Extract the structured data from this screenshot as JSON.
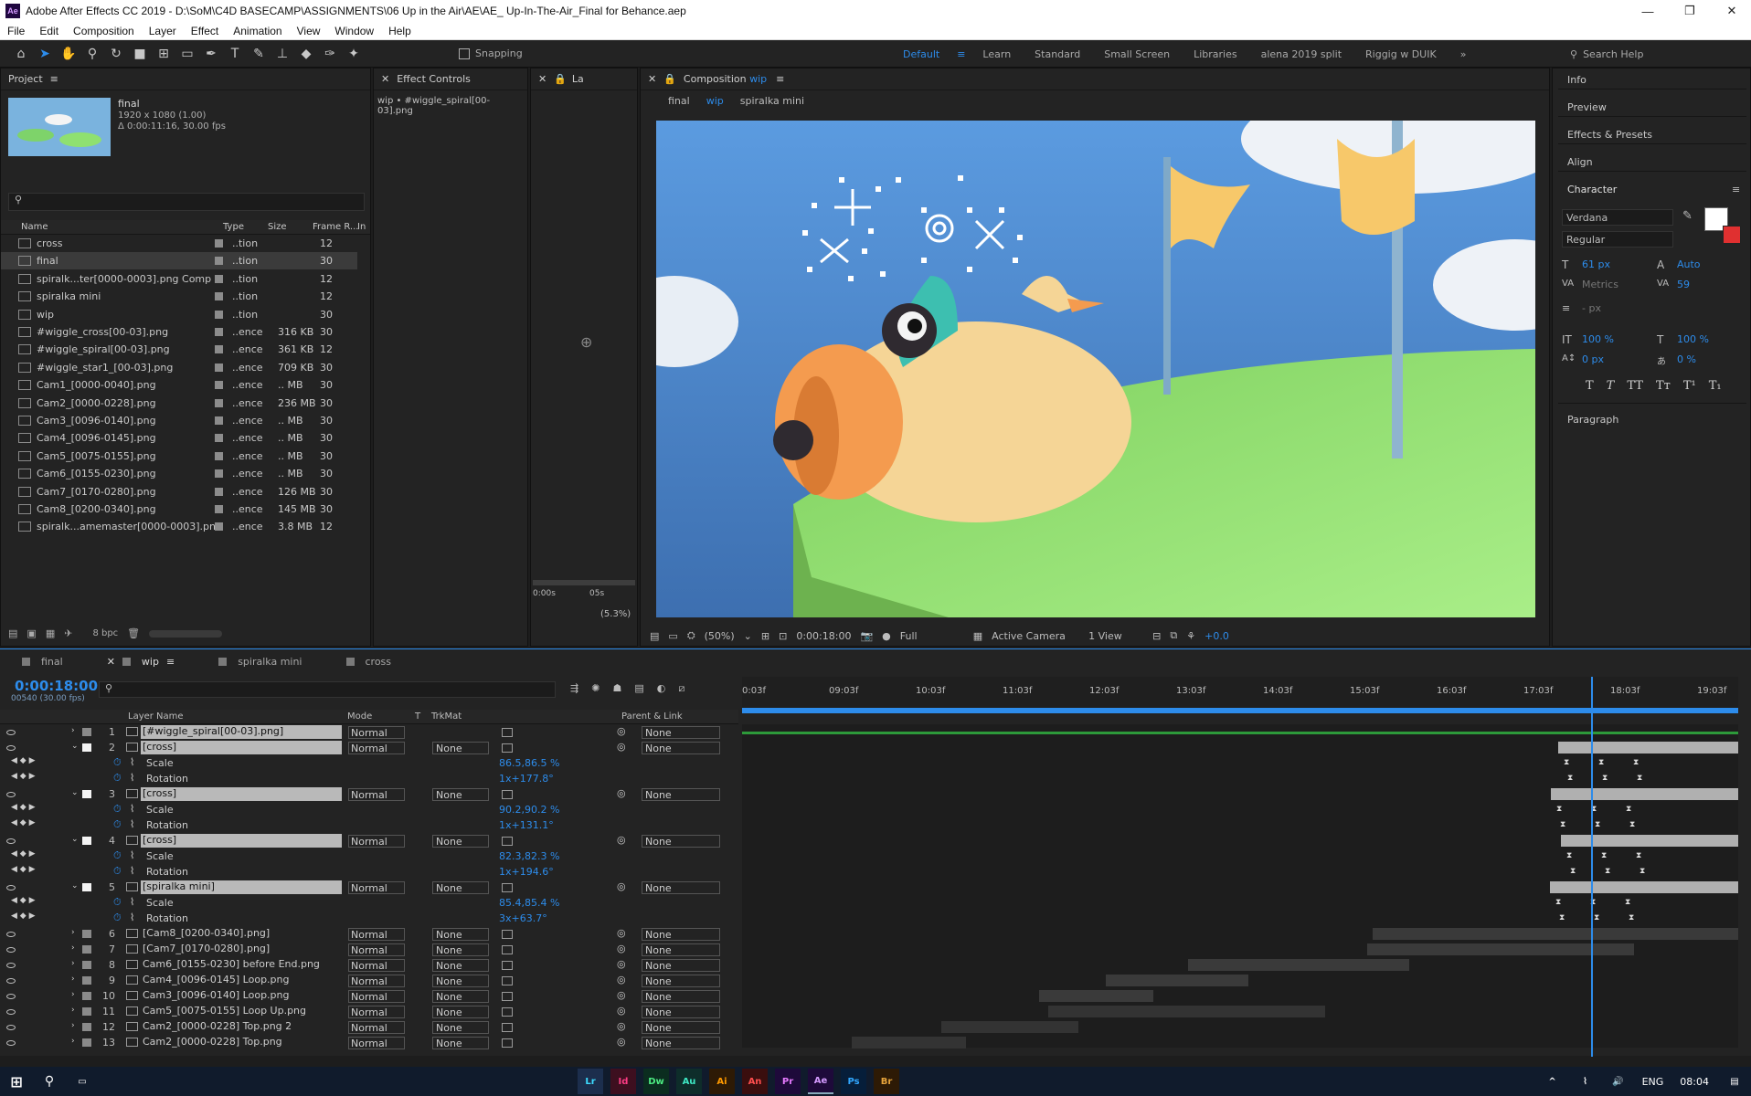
{
  "window": {
    "title": "Adobe After Effects CC 2019 - D:\\SoM\\C4D BASECAMP\\ASSIGNMENTS\\06 Up in the Air\\AE\\AE_ Up-In-The-Air_Final for Behance.aep",
    "app_badge": "Ae"
  },
  "menu": [
    "File",
    "Edit",
    "Composition",
    "Layer",
    "Effect",
    "Animation",
    "View",
    "Window",
    "Help"
  ],
  "toolbar": {
    "snapping": "Snapping",
    "workspaces": [
      "Default",
      "Learn",
      "Standard",
      "Small Screen",
      "Libraries",
      "alena 2019 split",
      "Riggig w DUIK"
    ],
    "search_help": "Search Help"
  },
  "project": {
    "title": "Project",
    "comp_name": "final",
    "comp_res": "1920 x 1080 (1.00)",
    "comp_dur": "Δ 0:00:11:16, 30.00 fps",
    "columns": [
      "Name",
      "Type",
      "Size",
      "Frame R...",
      "In"
    ],
    "items": [
      {
        "name": "cross",
        "type": "..tion",
        "size": "",
        "fr": "12"
      },
      {
        "name": "final",
        "type": "..tion",
        "size": "",
        "fr": "30"
      },
      {
        "name": "spiralk...ter[0000-0003].png Comp 2",
        "type": "..tion",
        "size": "",
        "fr": "12"
      },
      {
        "name": "spiralka mini",
        "type": "..tion",
        "size": "",
        "fr": "12"
      },
      {
        "name": "wip",
        "type": "..tion",
        "size": "",
        "fr": "30"
      },
      {
        "name": "#wiggle_cross[00-03].png",
        "type": "..ence",
        "size": "316 KB",
        "fr": "30"
      },
      {
        "name": "#wiggle_spiral[00-03].png",
        "type": "..ence",
        "size": "361 KB",
        "fr": "12"
      },
      {
        "name": "#wiggle_star1_[00-03].png",
        "type": "..ence",
        "size": "709 KB",
        "fr": "30"
      },
      {
        "name": "Cam1_[0000-0040].png",
        "type": "..ence",
        "size": ".. MB",
        "fr": "30"
      },
      {
        "name": "Cam2_[0000-0228].png",
        "type": "..ence",
        "size": "236 MB",
        "fr": "30"
      },
      {
        "name": "Cam3_[0096-0140].png",
        "type": "..ence",
        "size": ".. MB",
        "fr": "30"
      },
      {
        "name": "Cam4_[0096-0145].png",
        "type": "..ence",
        "size": ".. MB",
        "fr": "30"
      },
      {
        "name": "Cam5_[0075-0155].png",
        "type": "..ence",
        "size": ".. MB",
        "fr": "30"
      },
      {
        "name": "Cam6_[0155-0230].png",
        "type": "..ence",
        "size": ".. MB",
        "fr": "30"
      },
      {
        "name": "Cam7_[0170-0280].png",
        "type": "..ence",
        "size": "126 MB",
        "fr": "30"
      },
      {
        "name": "Cam8_[0200-0340].png",
        "type": "..ence",
        "size": "145 MB",
        "fr": "30"
      },
      {
        "name": "spiralk...amemaster[0000-0003].png",
        "type": "..ence",
        "size": "3.8 MB",
        "fr": "12"
      }
    ],
    "bpc": "8 bpc"
  },
  "effect_controls": {
    "title": "Effect Controls",
    "layer": "wip • #wiggle_spiral[00-03].png"
  },
  "layer_panel": {
    "title": "La",
    "t0": "0:00s",
    "t1": "05s",
    "zoom": "(5.3%)"
  },
  "comp": {
    "title": "Composition",
    "name": "wip",
    "breadcrumbs": [
      "final",
      "wip",
      "spiralka mini"
    ],
    "zoom": "(50%)",
    "time": "0:00:18:00",
    "res": "Full",
    "camera": "Active Camera",
    "views": "1 View",
    "exposure": "+0.0"
  },
  "right": {
    "sections": [
      "Info",
      "Preview",
      "Effects & Presets",
      "Align",
      "Character",
      "Paragraph"
    ],
    "font": "Verdana",
    "style": "Regular",
    "size": "61 px",
    "leading": "Auto",
    "kerning": "Metrics",
    "tracking": "59",
    "stroke": "- px",
    "vscale": "100 %",
    "hscale": "100 %",
    "baseline": "0 px",
    "tsume": "0 %"
  },
  "timeline": {
    "tabs": [
      "final",
      "wip",
      "spiralka mini",
      "cross"
    ],
    "current_time": "0:00:18:00",
    "fps_label": "00540 (30.00 fps)",
    "header": {
      "layer": "Layer Name",
      "mode": "Mode",
      "t": "T",
      "trk": "TrkMat",
      "parent": "Parent & Link"
    },
    "ruler": [
      "0:03f",
      "09:03f",
      "10:03f",
      "11:03f",
      "12:03f",
      "13:03f",
      "14:03f",
      "15:03f",
      "16:03f",
      "17:03f",
      "18:03f",
      "19:03f"
    ],
    "layers": [
      {
        "num": "1",
        "name": "[#wiggle_spiral[00-03].png]",
        "mode": "Normal",
        "trk": "",
        "parent": "None",
        "hi": true
      },
      {
        "num": "2",
        "name": "[cross]",
        "mode": "Normal",
        "trk": "None",
        "parent": "None",
        "hi": true,
        "props": [
          {
            "n": "Scale",
            "v": "86.5,86.5 %"
          },
          {
            "n": "Rotation",
            "v": "1x+177.8°"
          }
        ]
      },
      {
        "num": "3",
        "name": "[cross]",
        "mode": "Normal",
        "trk": "None",
        "parent": "None",
        "hi": true,
        "props": [
          {
            "n": "Scale",
            "v": "90.2,90.2 %"
          },
          {
            "n": "Rotation",
            "v": "1x+131.1°"
          }
        ]
      },
      {
        "num": "4",
        "name": "[cross]",
        "mode": "Normal",
        "trk": "None",
        "parent": "None",
        "hi": true,
        "props": [
          {
            "n": "Scale",
            "v": "82.3,82.3 %"
          },
          {
            "n": "Rotation",
            "v": "1x+194.6°"
          }
        ]
      },
      {
        "num": "5",
        "name": "[spiralka mini]",
        "mode": "Normal",
        "trk": "None",
        "parent": "None",
        "hi": true,
        "props": [
          {
            "n": "Scale",
            "v": "85.4,85.4 %"
          },
          {
            "n": "Rotation",
            "v": "3x+63.7°"
          }
        ]
      },
      {
        "num": "6",
        "name": "[Cam8_[0200-0340].png]",
        "mode": "Normal",
        "trk": "None",
        "parent": "None"
      },
      {
        "num": "7",
        "name": "[Cam7_[0170-0280].png]",
        "mode": "Normal",
        "trk": "None",
        "parent": "None"
      },
      {
        "num": "8",
        "name": "Cam6_[0155-0230] before End.png",
        "mode": "Normal",
        "trk": "None",
        "parent": "None"
      },
      {
        "num": "9",
        "name": "Cam4_[0096-0145] Loop.png",
        "mode": "Normal",
        "trk": "None",
        "parent": "None"
      },
      {
        "num": "10",
        "name": "Cam3_[0096-0140] Loop.png",
        "mode": "Normal",
        "trk": "None",
        "parent": "None"
      },
      {
        "num": "11",
        "name": "Cam5_[0075-0155] Loop Up.png",
        "mode": "Normal",
        "trk": "None",
        "parent": "None"
      },
      {
        "num": "12",
        "name": "Cam2_[0000-0228] Top.png 2",
        "mode": "Normal",
        "trk": "None",
        "parent": "None"
      },
      {
        "num": "13",
        "name": "Cam2_[0000-0228] Top.png",
        "mode": "Normal",
        "trk": "None",
        "parent": "None"
      }
    ]
  },
  "taskbar": {
    "lang": "ENG",
    "clock": "08:04",
    "apps": [
      "Lr",
      "Id",
      "Dw",
      "Au",
      "Ai",
      "An",
      "Pr",
      "Ae",
      "Ps",
      "Br"
    ]
  }
}
